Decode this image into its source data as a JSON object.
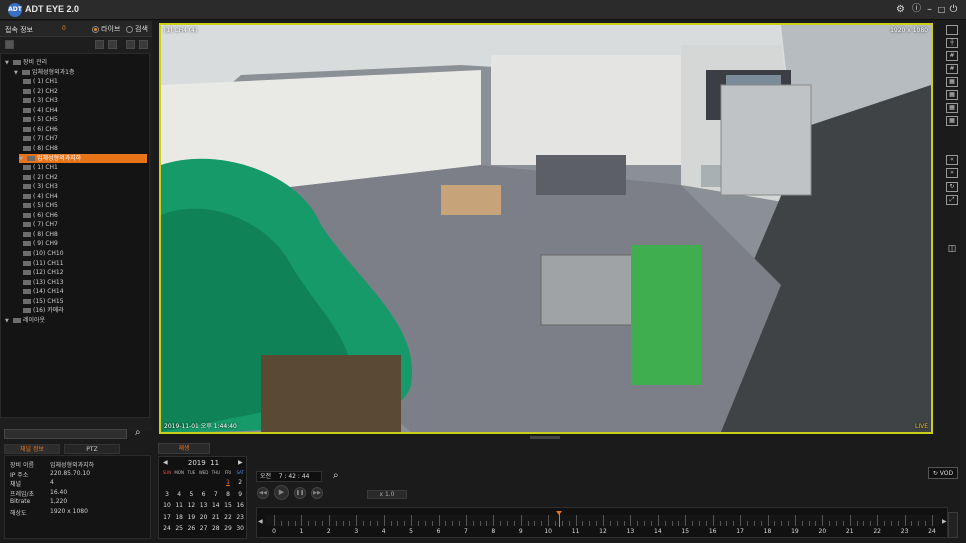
{
  "app": {
    "title": "ADT EYE 2.0",
    "logo_text": "ADT"
  },
  "left_panel": {
    "title": "접속 정보",
    "count": "0",
    "radio_live": "라이브",
    "radio_search": "검색",
    "tree": [
      "장비 관리",
      "입체성형외과1층",
      "( 1) CH1",
      "( 2) CH2",
      "( 3) CH3",
      "( 4) CH4",
      "( 5) CH5",
      "( 6) CH6",
      "( 7) CH7",
      "( 8) CH8",
      "입체성형외과지하",
      "( 1) CH1",
      "( 2) CH2",
      "( 3) CH3",
      "( 4) CH4",
      "( 5) CH5",
      "( 6) CH6",
      "( 7) CH7",
      "( 8) CH8",
      "( 9) CH9",
      "(10) CH10",
      "(11) CH11",
      "(12) CH12",
      "(13) CH13",
      "(14) CH14",
      "(15) CH15",
      "(16) 카메라",
      "레이아웃"
    ],
    "selected_index": 10
  },
  "info_tabs": [
    "채널 정보",
    "PTZ"
  ],
  "channel_info": {
    "rows": [
      {
        "label": "장비 이름",
        "value": "입체성형외과지하"
      },
      {
        "label": "IP 주소",
        "value": "220.85.70.10"
      },
      {
        "label": "채널",
        "value": "4"
      },
      {
        "label": "프레임/초",
        "value": "16.40"
      },
      {
        "label": "Bitrate",
        "value": "1,220"
      },
      {
        "label": "해상도",
        "value": "1920 x 1080"
      }
    ]
  },
  "video": {
    "channel_label": "[1] CH4 (4)",
    "resolution": "1920 x 1080",
    "timestamp": "2019-11-01 오후 1:44:40",
    "status": "LIVE"
  },
  "playback": {
    "tab": "재생",
    "calendar": {
      "year": "2019",
      "month": "11",
      "days_of_week": [
        "SUN",
        "MON",
        "TUE",
        "WED",
        "THU",
        "FRI",
        "SAT"
      ],
      "weeks": [
        [
          "",
          "",
          "",
          "",
          "",
          "1",
          "2"
        ],
        [
          "3",
          "4",
          "5",
          "6",
          "7",
          "8",
          "9"
        ],
        [
          "10",
          "11",
          "12",
          "13",
          "14",
          "15",
          "16"
        ],
        [
          "17",
          "18",
          "19",
          "20",
          "21",
          "22",
          "23"
        ],
        [
          "24",
          "25",
          "26",
          "27",
          "28",
          "29",
          "30"
        ]
      ],
      "highlight_day": "1"
    },
    "time": {
      "ampm": "오전",
      "hour": "7",
      "minute": "42",
      "second": "44"
    },
    "speed": "x 1.0",
    "vod_label": "VOD",
    "timeline_hours": [
      "0",
      "1",
      "2",
      "3",
      "4",
      "5",
      "6",
      "7",
      "8",
      "9",
      "10",
      "11",
      "12",
      "13",
      "14",
      "15",
      "16",
      "17",
      "18",
      "19",
      "20",
      "21",
      "22",
      "23",
      "24"
    ],
    "cursor_hour": 10.4
  },
  "colors": {
    "accent": "#e8741a",
    "video_border": "#c9cf1a"
  }
}
